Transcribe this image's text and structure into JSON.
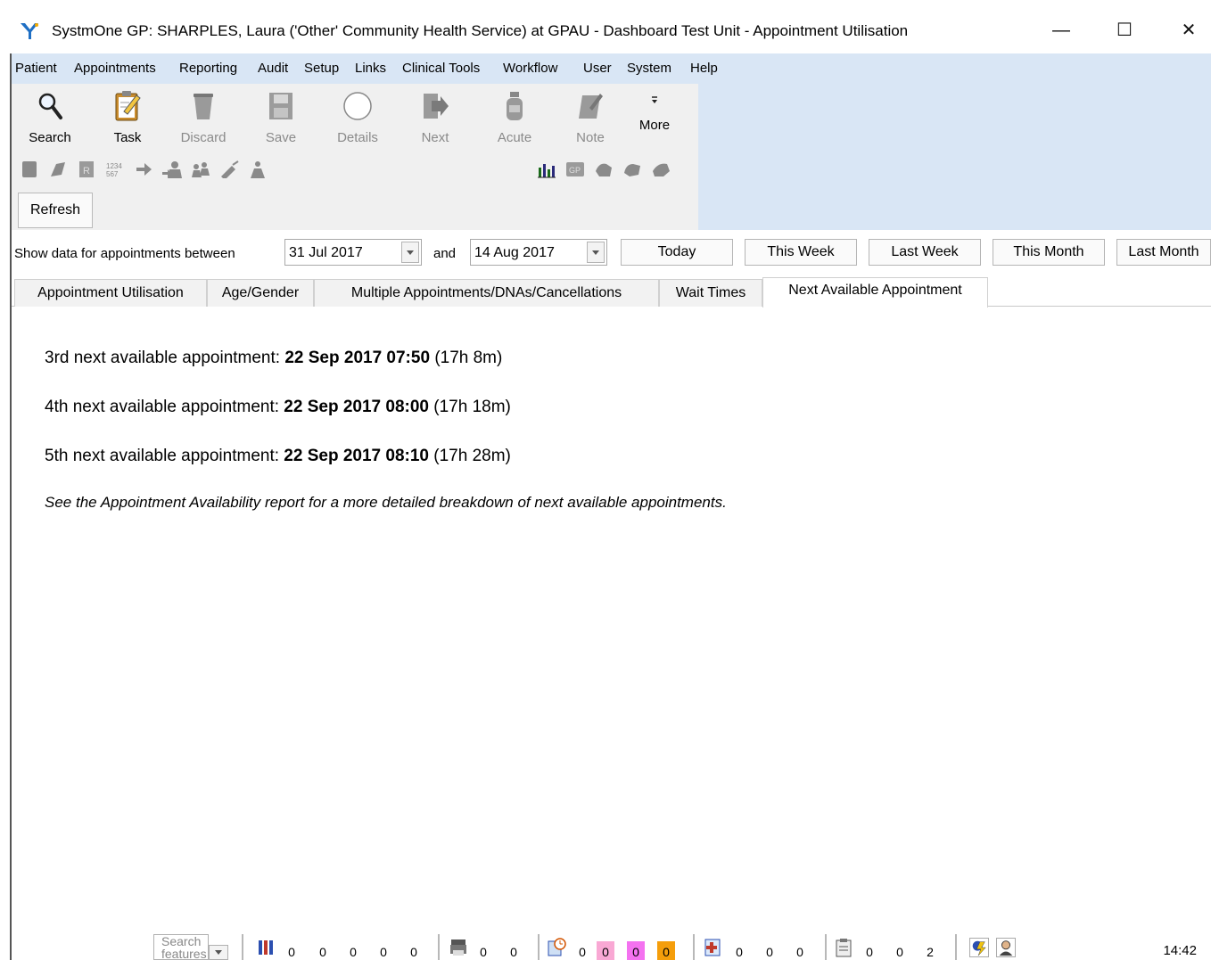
{
  "window": {
    "title": "SystmOne GP: SHARPLES, Laura ('Other' Community Health Service) at GPAU - Dashboard Test Unit - Appointment Utilisation",
    "minimize_glyph": "—",
    "maximize_glyph": "☐",
    "close_glyph": "✕"
  },
  "menu": [
    "Patient",
    "Appointments",
    "Reporting",
    "Audit",
    "Setup",
    "Links",
    "Clinical Tools",
    "Workflow",
    "User",
    "System",
    "Help"
  ],
  "toolbar": {
    "search": "Search",
    "task": "Task",
    "discard": "Discard",
    "save": "Save",
    "details": "Details",
    "next": "Next",
    "acute": "Acute",
    "note": "Note",
    "more": "More",
    "refresh": "Refresh"
  },
  "date_filter": {
    "label": "Show data for appointments between",
    "from": "31 Jul 2017",
    "and_label": "and",
    "to": "14 Aug 2017",
    "quick": [
      "Today",
      "This Week",
      "Last Week",
      "This Month",
      "Last Month"
    ]
  },
  "tabs": [
    "Appointment Utilisation",
    "Age/Gender",
    "Multiple Appointments/DNAs/Cancellations",
    "Wait Times",
    "Next Available Appointment"
  ],
  "active_tab": "Next Available Appointment",
  "next_available": [
    {
      "label": "3rd next available appointment:",
      "datetime": "22 Sep 2017 07:50",
      "wait": "(17h 8m)"
    },
    {
      "label": "4th next available appointment:",
      "datetime": "22 Sep 2017 08:00",
      "wait": "(17h 18m)"
    },
    {
      "label": "5th next available appointment:",
      "datetime": "22 Sep 2017 08:10",
      "wait": "(17h 28m)"
    }
  ],
  "note": "See the Appointment Availability report for a more detailed breakdown of next available appointments.",
  "status": {
    "search_placeholder": "Search features",
    "group1": [
      "0",
      "0",
      "0",
      "0",
      "0"
    ],
    "group2": [
      "0",
      "0"
    ],
    "group3": [
      "0",
      "0",
      "0",
      "0"
    ],
    "group4": [
      "0",
      "0",
      "0"
    ],
    "group5": [
      "0",
      "0",
      "2"
    ],
    "time": "14:42",
    "highlight_colors": {
      "pink": "#f9a8d4",
      "magenta": "#f472f0",
      "orange": "#f59e0b"
    }
  }
}
